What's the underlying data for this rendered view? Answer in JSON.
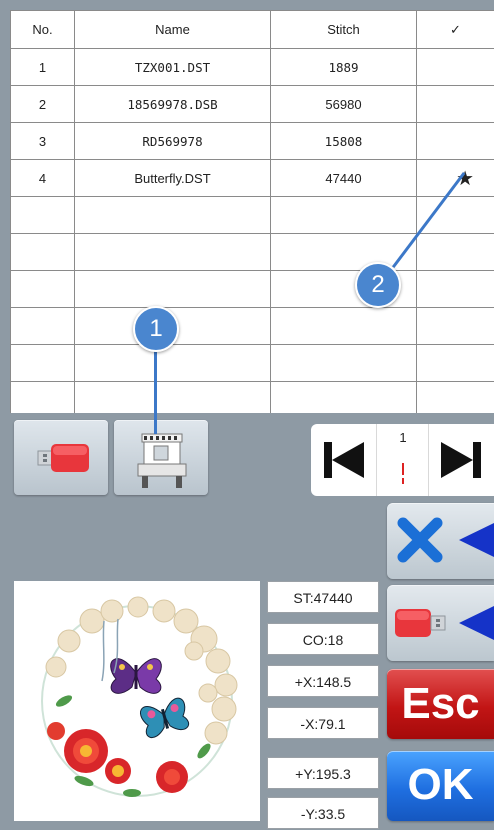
{
  "table": {
    "headers": {
      "no": "No.",
      "name": "Name",
      "stitch": "Stitch",
      "check": "✓"
    },
    "rows": [
      {
        "no": "1",
        "name": "TZX001.DST",
        "stitch": "1889",
        "mark": ""
      },
      {
        "no": "2",
        "name": "18569978.DSB",
        "stitch": "56980",
        "mark": ""
      },
      {
        "no": "3",
        "name": "RD569978",
        "stitch": "15808",
        "mark": ""
      },
      {
        "no": "4",
        "name": "Butterfly.DST",
        "stitch": "47440",
        "mark": "★"
      }
    ]
  },
  "callouts": {
    "one": "1",
    "two": "2"
  },
  "pager": {
    "page": "1"
  },
  "readouts": {
    "st": "ST:47440",
    "co": "CO:18",
    "plus_x": "+X:148.5",
    "minus_x": "-X:79.1",
    "plus_y": "+Y:195.3",
    "minus_y": "-Y:33.5"
  },
  "buttons": {
    "esc": "Esc",
    "ok": "OK"
  },
  "icons": {
    "usb": "usb-drive-icon",
    "machine": "embroidery-machine-icon",
    "first": "skip-previous-icon",
    "last": "skip-next-icon",
    "delete": "delete-x-icon",
    "save_usb": "usb-export-icon"
  }
}
